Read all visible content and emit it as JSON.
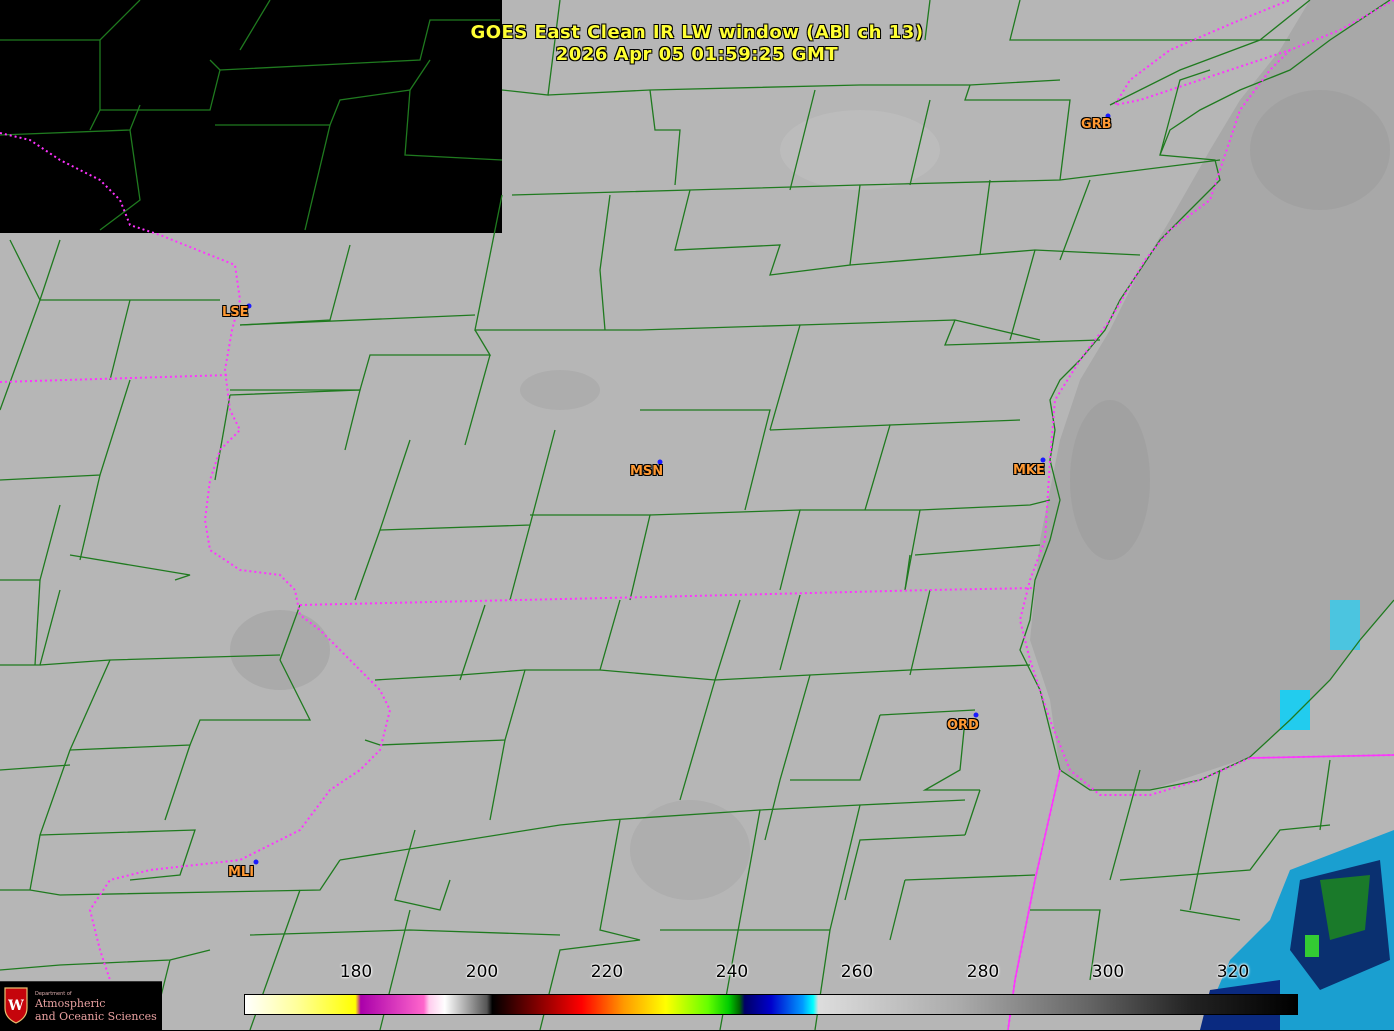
{
  "title": {
    "line1": "GOES East Clean IR LW window (ABI ch 13)",
    "line2": "2026 Apr 05  01:59:25 GMT"
  },
  "cities": [
    {
      "id": "lse",
      "label": "LSE"
    },
    {
      "id": "grb",
      "label": "GRB"
    },
    {
      "id": "msn",
      "label": "MSN"
    },
    {
      "id": "mke",
      "label": "MKE"
    },
    {
      "id": "ord",
      "label": "ORD"
    },
    {
      "id": "mli",
      "label": "MLI"
    }
  ],
  "colorbar": {
    "ticks": [
      "180",
      "200",
      "220",
      "240",
      "260",
      "280",
      "300",
      "320"
    ],
    "range": [
      163,
      330
    ]
  },
  "logo": {
    "dept": "Department of",
    "name_line1": "Atmospheric",
    "name_line2": "and Oceanic Sciences"
  },
  "colors": {
    "title": "#ffff33",
    "city_label": "#ff9933",
    "city_dot": "#1a1aff",
    "county_lines": "#1f7a1f",
    "state_lines": "#ff33ff",
    "background_no_data": "#000000",
    "cloud_gray": "#b4b4b4"
  }
}
